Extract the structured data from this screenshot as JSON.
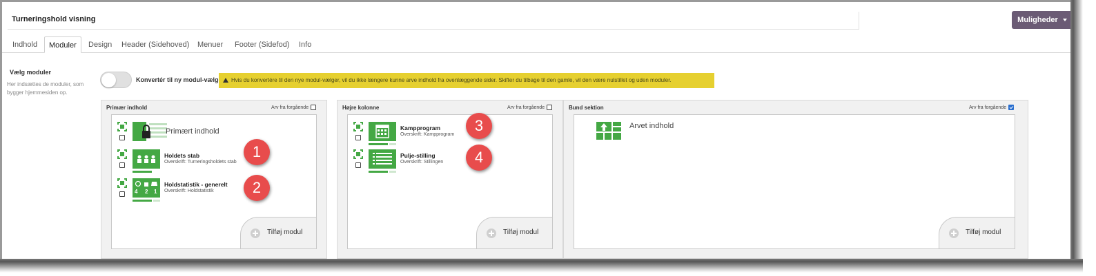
{
  "page": {
    "title": "Turneringshold visning",
    "options_button": "Muligheder"
  },
  "tabs": [
    {
      "label": "Indhold",
      "active": false
    },
    {
      "label": "Moduler",
      "active": true
    },
    {
      "label": "Design",
      "active": false
    },
    {
      "label": "Header (Sidehoved)",
      "active": false
    },
    {
      "label": "Menuer",
      "active": false
    },
    {
      "label": "Footer (Sidefod)",
      "active": false
    },
    {
      "label": "Info",
      "active": false
    }
  ],
  "side": {
    "title": "Vælg moduler",
    "description": "Her indsættes de moduler, som bygger hjemmesiden op."
  },
  "convert": {
    "label": "Konvertér til ny modul-vælger",
    "enabled": false,
    "warning": "Hvis du konvertére til den nye modul-vælger, vil du ikke længere kunne arve indhold fra ovenlæggende sider. Skifter du tilbage til den gamle, vil den være nulstillet og uden moduler."
  },
  "panels": {
    "primary": {
      "title": "Primær indhold",
      "inherit_label": "Arv fra forgående",
      "inherit_checked": false,
      "modules": [
        {
          "name": "Primært indhold",
          "subtitle": "",
          "icon": "lock-icon"
        },
        {
          "name": "Holdets stab",
          "subtitle": "Overskrift: Turneringsholdets stab",
          "icon": "staff-icon",
          "badge": "1"
        },
        {
          "name": "Holdstatistik - generelt",
          "subtitle": "Overskrift: Holdstatistik",
          "icon": "team-stats-icon",
          "badge": "2",
          "stats": [
            "4",
            "2",
            "1"
          ]
        }
      ],
      "add_label": "Tilføj modul"
    },
    "right": {
      "title": "Højre kolonne",
      "inherit_label": "Arv fra forgående",
      "inherit_checked": false,
      "modules": [
        {
          "name": "Kampprogram",
          "subtitle": "Overskrift: Kampprogram",
          "icon": "calendar-icon",
          "badge": "3"
        },
        {
          "name": "Pulje-stilling",
          "subtitle": "Overskrift: Stillingen",
          "icon": "standings-icon",
          "badge": "4"
        }
      ],
      "add_label": "Tilføj modul"
    },
    "bottom": {
      "title": "Bund sektion",
      "inherit_label": "Arv fra forgående",
      "inherit_checked": true,
      "inherited_label": "Arvet indhold",
      "add_label": "Tilføj modul"
    }
  },
  "colors": {
    "module_green": "#44a844",
    "options_button": "#6b5b75",
    "warning_bg": "#e6d030",
    "badge_red": "#e84c4c"
  }
}
